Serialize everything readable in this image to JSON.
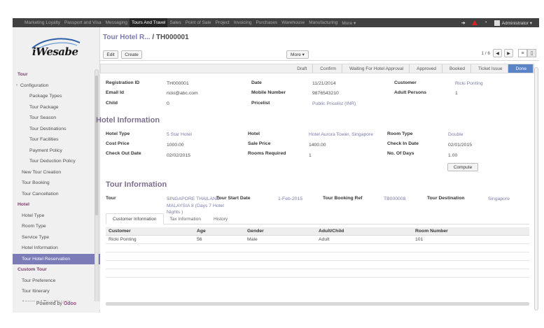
{
  "topbar": {
    "menus": [
      "Marketing Loyalty",
      "Passport and Visa",
      "Messaging",
      "Tours And Travel",
      "Sales",
      "Point of Sale",
      "Project",
      "Invoicing",
      "Purchases",
      "Warehouse",
      "Manufacturing",
      "More ▾"
    ],
    "active_menu": "Tours And Travel",
    "user": "Administrator ▾"
  },
  "logo": {
    "text": "iWesabe"
  },
  "sidebar": {
    "rows": [
      {
        "label": "Tour",
        "kind": "sect"
      },
      {
        "label": "Configuration",
        "kind": "parent"
      },
      {
        "label": "Package Types",
        "kind": "sub"
      },
      {
        "label": "Tour Package",
        "kind": "sub"
      },
      {
        "label": "Tour Season",
        "kind": "sub"
      },
      {
        "label": "Tour Destinations",
        "kind": "sub"
      },
      {
        "label": "Tour Facilities",
        "kind": "sub"
      },
      {
        "label": "Payment Policy",
        "kind": "sub"
      },
      {
        "label": "Tour Deduction Policy",
        "kind": "sub"
      },
      {
        "label": "New Tour Creation",
        "kind": "item"
      },
      {
        "label": "Tour Booking",
        "kind": "item"
      },
      {
        "label": "Tour Cancellation",
        "kind": "item"
      },
      {
        "label": "Hotel",
        "kind": "sect"
      },
      {
        "label": "Hotel Type",
        "kind": "item"
      },
      {
        "label": "Room Type",
        "kind": "item"
      },
      {
        "label": "Service Type",
        "kind": "item"
      },
      {
        "label": "Hotel Information",
        "kind": "item"
      },
      {
        "label": "Tour Hotel Reservation",
        "kind": "item active"
      },
      {
        "label": "Custom Tour",
        "kind": "sect"
      },
      {
        "label": "Tour Preference",
        "kind": "item"
      },
      {
        "label": "Tour Itinerary",
        "kind": "item"
      },
      {
        "label": "Approved Tour Itinerary",
        "kind": "item"
      }
    ],
    "powered_prefix": "Powered by",
    "powered_brand": "Odoo"
  },
  "header": {
    "breadcrumb_parent": "Tour Hotel R...",
    "breadcrumb_sep": " / ",
    "breadcrumb_current": "TH000001",
    "edit_label": "Edit",
    "create_label": "Create",
    "more_label": "More ▾",
    "pager": "1 / 6"
  },
  "statusbar": {
    "stages": [
      "Draft",
      "Confirm",
      "Waiting For Hotel Approval",
      "Approved",
      "Booked",
      "Ticket Issue",
      "Done"
    ],
    "current": "Done"
  },
  "form": {
    "reg_id_label": "Registration ID",
    "reg_id": "TH000001",
    "date_label": "Date",
    "date": "11/21/2014",
    "customer_label": "Customer",
    "customer": "Ricki Ponting",
    "email_label": "Email Id",
    "email": "ricki@abc.com",
    "mobile_label": "Mobile Number",
    "mobile": "9876543210",
    "adults_label": "Adult Persons",
    "adults": "1",
    "child_label": "Child",
    "child": "0",
    "pricelist_label": "Pricelist",
    "pricelist": "Public Pricelist (INR)"
  },
  "hotel": {
    "title": "Hotel Information",
    "hotel_type_label": "Hotel Type",
    "hotel_type": "5 Star Hotel",
    "hotel_label": "Hotel",
    "hotel": "Hotel Aurora Tower, Singapore",
    "room_type_label": "Room Type",
    "room_type": "Double",
    "cost_label": "Cost Price",
    "cost": "1000.00",
    "sale_label": "Sale Price",
    "sale": "1400.00",
    "checkin_label": "Check In Date",
    "checkin": "02/01/2015",
    "checkout_label": "Check Out Date",
    "checkout": "02/02/2015",
    "rooms_label": "Rooms Required",
    "rooms": "1",
    "days_label": "No. Of Days",
    "days": "1.00",
    "compute_label": "Compute"
  },
  "tour": {
    "title": "Tour Information",
    "tour_label": "Tour",
    "tour_value": "SINGAPORE THAILAND MALAYSIA 8 (Days 7 Hotel Nights )",
    "start_label": "Tour Start Date",
    "start": "1-Feb-2015",
    "ref_label": "Tour Booking Ref",
    "ref": "TB000008",
    "dest_label": "Tour Destination",
    "dest": "Singapore"
  },
  "tabs": [
    "Customer Information",
    "Tax Information",
    "History"
  ],
  "table": {
    "headers": [
      "Customer",
      "Age",
      "Gender",
      "Adult/Child",
      "Room Number"
    ],
    "rows": [
      [
        "Ricki Ponting",
        "56",
        "Male",
        "Adult",
        "101"
      ]
    ]
  }
}
